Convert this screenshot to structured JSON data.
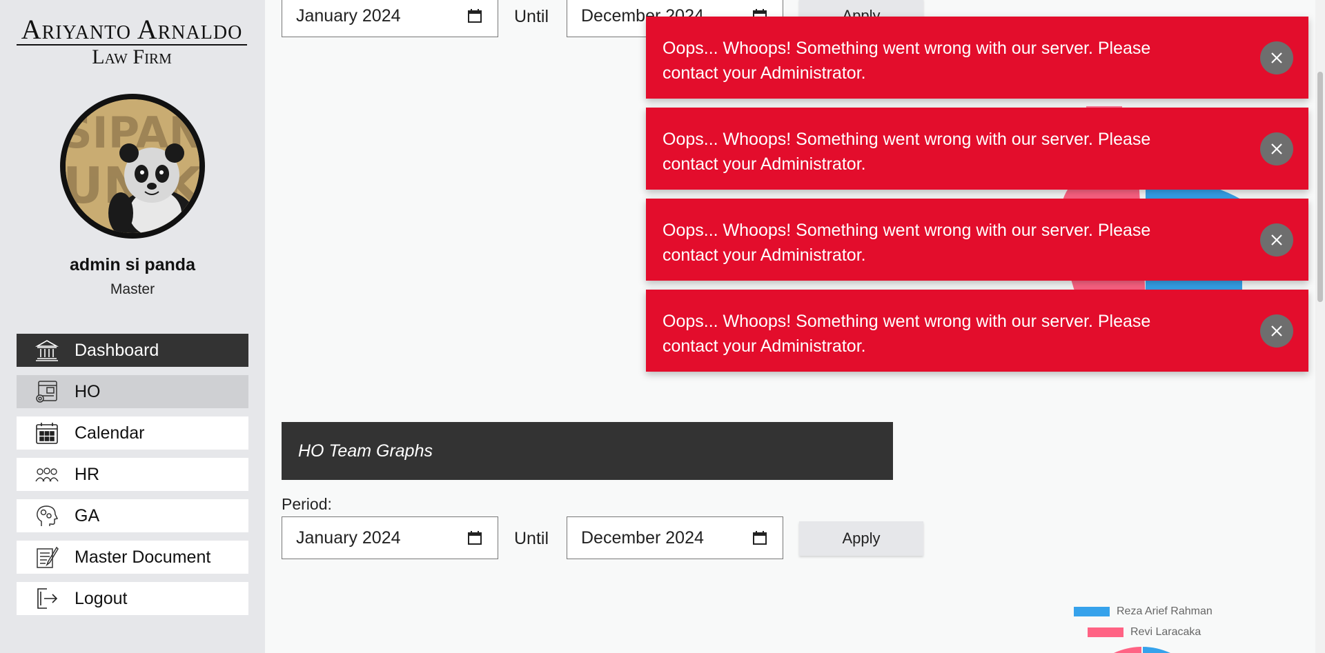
{
  "brand": {
    "line1": "Ariyanto Arnaldo",
    "line2": "Law Firm",
    "avatar_text": "SIPANDA UNIK"
  },
  "user": {
    "name": "admin si panda",
    "role": "Master"
  },
  "menu": [
    {
      "label": "Dashboard",
      "icon": "bank-icon"
    },
    {
      "label": "HO",
      "icon": "office-settings-icon"
    },
    {
      "label": "Calendar",
      "icon": "calendar-icon"
    },
    {
      "label": "HR",
      "icon": "people-icon"
    },
    {
      "label": "GA",
      "icon": "head-gears-icon"
    },
    {
      "label": "Master Document",
      "icon": "document-pen-icon"
    },
    {
      "label": "Logout",
      "icon": "logout-icon"
    }
  ],
  "top_filter": {
    "from": "January 2024",
    "until_label": "Until",
    "to": "December 2024",
    "apply": "Apply"
  },
  "ho_team": {
    "title": "HO Team Graphs",
    "period_label": "Period:",
    "from": "January 2024",
    "until_label": "Until",
    "to": "December 2024",
    "apply": "Apply",
    "legend": [
      {
        "name": "Reza Arief Rahman",
        "color": "#36a2eb"
      },
      {
        "name": "Revi Laracaka",
        "color": "#ff6384"
      }
    ]
  },
  "toasts": [
    {
      "message": "Oops... Whoops! Something went wrong with our server. Please contact your Administrator."
    },
    {
      "message": "Oops... Whoops! Something went wrong with our server. Please contact your Administrator."
    },
    {
      "message": "Oops... Whoops! Something went wrong with our server. Please contact your Administrator."
    },
    {
      "message": "Oops... Whoops! Something went wrong with our server. Please contact your Administrator."
    }
  ],
  "colors": {
    "toast_bg": "#e30d2c",
    "active_menu": "#333333",
    "series_blue": "#36a2eb",
    "series_pink": "#ff6384"
  }
}
